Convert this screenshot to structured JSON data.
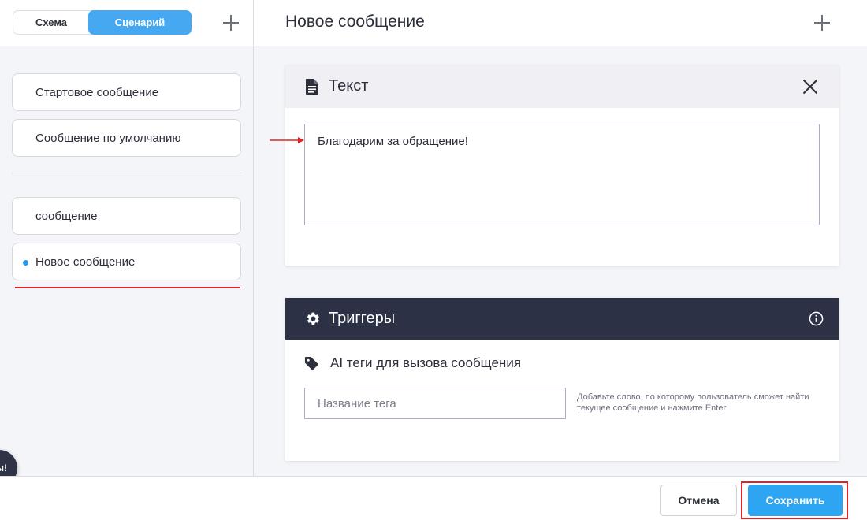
{
  "sidebar": {
    "tabs": [
      {
        "label": "Схема"
      },
      {
        "label": "Сценарий"
      }
    ],
    "items": [
      {
        "label": "Стартовое сообщение"
      },
      {
        "label": "Сообщение по умолчанию"
      },
      {
        "label": "сообщение"
      },
      {
        "label": "Новое сообщение"
      }
    ],
    "chat_fab_label": "ы!"
  },
  "main": {
    "title": "Новое сообщение",
    "text_card": {
      "title": "Текст",
      "value": "Благодарим за обращение!"
    },
    "triggers_card": {
      "title": "Триггеры",
      "tags_label": "AI теги для вызова сообщения",
      "tag_placeholder": "Название тега",
      "hint": "Добавьте слово, по которому пользователь сможет найти текущее сообщение и нажмите Enter"
    }
  },
  "footer": {
    "cancel_label": "Отмена",
    "save_label": "Сохранить"
  },
  "colors": {
    "accent": "#46a8f0",
    "triggers_header": "#2d3146",
    "annotation": "#e02424"
  },
  "icons": [
    "plus-icon",
    "document-icon",
    "close-icon",
    "gear-icon",
    "info-icon",
    "tag-icon"
  ]
}
